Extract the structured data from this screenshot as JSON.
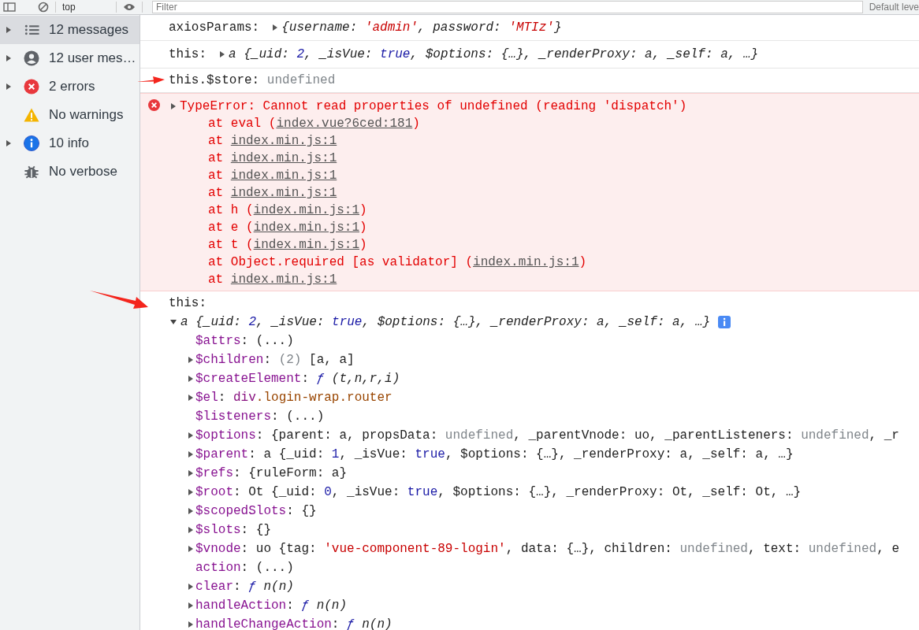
{
  "toolbar": {
    "context": "top",
    "filter": {
      "placeholder": "Filter"
    },
    "levels": "Default leve"
  },
  "sidebar": {
    "items": [
      {
        "label": "12 messages",
        "kind": "list",
        "expandable": true,
        "selected": true
      },
      {
        "label": "12 user mes…",
        "kind": "user",
        "expandable": true,
        "selected": false
      },
      {
        "label": "2 errors",
        "kind": "error",
        "expandable": true,
        "selected": false
      },
      {
        "label": "No warnings",
        "kind": "warning",
        "expandable": false,
        "selected": false
      },
      {
        "label": "10 info",
        "kind": "info",
        "expandable": true,
        "selected": false
      },
      {
        "label": "No verbose",
        "kind": "verbose",
        "expandable": false,
        "selected": false
      }
    ]
  },
  "console": {
    "messages": [
      {
        "kind": "log",
        "lines": [
          {
            "parts": [
              {
                "kind": "text",
                "segs": [
                  {
                    "kind": "plain",
                    "text": "axiosParams:"
                  }
                ]
              },
              {
                "kind": "toggle",
                "expanded": false
              },
              {
                "kind": "text",
                "segs": [
                  {
                    "kind": "italic",
                    "text": "{username: "
                  },
                  {
                    "kind": "istring",
                    "text": "'admin'"
                  },
                  {
                    "kind": "italic",
                    "text": ", password: "
                  },
                  {
                    "kind": "istring",
                    "text": "'MTIz'"
                  },
                  {
                    "kind": "italic",
                    "text": "}"
                  }
                ]
              }
            ]
          }
        ]
      },
      {
        "kind": "log",
        "lines": [
          {
            "parts": [
              {
                "kind": "text",
                "segs": [
                  {
                    "kind": "plain",
                    "text": "this:"
                  }
                ]
              },
              {
                "kind": "toggle",
                "expanded": false
              },
              {
                "kind": "text",
                "segs": [
                  {
                    "kind": "italic",
                    "text": "a {_uid: "
                  },
                  {
                    "kind": "inumber",
                    "text": "2"
                  },
                  {
                    "kind": "italic",
                    "text": ", _isVue: "
                  },
                  {
                    "kind": "inumber",
                    "text": "true"
                  },
                  {
                    "kind": "italic",
                    "text": ", $options: {…}, _renderProxy: a, _self: a, …}"
                  }
                ]
              }
            ]
          }
        ]
      },
      {
        "kind": "log",
        "lines": [
          {
            "parts": [
              {
                "kind": "text",
                "segs": [
                  {
                    "kind": "plain",
                    "text": "this.$store: "
                  },
                  {
                    "kind": "undef",
                    "text": "undefined"
                  }
                ]
              }
            ]
          }
        ]
      },
      {
        "kind": "error",
        "lines": [
          {
            "parts": [
              {
                "kind": "toggle",
                "expanded": false
              },
              {
                "kind": "text",
                "segs": [
                  {
                    "kind": "err",
                    "text": "TypeError: Cannot read properties of undefined (reading 'dispatch')"
                  }
                ]
              }
            ]
          },
          {
            "parts": [
              {
                "kind": "text",
                "segs": [
                  {
                    "kind": "err",
                    "text": "at eval ("
                  },
                  {
                    "kind": "link",
                    "text": "index.vue?6ced:181"
                  },
                  {
                    "kind": "err",
                    "text": ")"
                  }
                ]
              }
            ]
          },
          {
            "parts": [
              {
                "kind": "text",
                "segs": [
                  {
                    "kind": "err",
                    "text": "at "
                  },
                  {
                    "kind": "link",
                    "text": "index.min.js:1"
                  }
                ]
              }
            ]
          },
          {
            "parts": [
              {
                "kind": "text",
                "segs": [
                  {
                    "kind": "err",
                    "text": "at "
                  },
                  {
                    "kind": "link",
                    "text": "index.min.js:1"
                  }
                ]
              }
            ]
          },
          {
            "parts": [
              {
                "kind": "text",
                "segs": [
                  {
                    "kind": "err",
                    "text": "at "
                  },
                  {
                    "kind": "link",
                    "text": "index.min.js:1"
                  }
                ]
              }
            ]
          },
          {
            "parts": [
              {
                "kind": "text",
                "segs": [
                  {
                    "kind": "err",
                    "text": "at "
                  },
                  {
                    "kind": "link",
                    "text": "index.min.js:1"
                  }
                ]
              }
            ]
          },
          {
            "parts": [
              {
                "kind": "text",
                "segs": [
                  {
                    "kind": "err",
                    "text": "at h ("
                  },
                  {
                    "kind": "link",
                    "text": "index.min.js:1"
                  },
                  {
                    "kind": "err",
                    "text": ")"
                  }
                ]
              }
            ]
          },
          {
            "parts": [
              {
                "kind": "text",
                "segs": [
                  {
                    "kind": "err",
                    "text": "at e ("
                  },
                  {
                    "kind": "link",
                    "text": "index.min.js:1"
                  },
                  {
                    "kind": "err",
                    "text": ")"
                  }
                ]
              }
            ]
          },
          {
            "parts": [
              {
                "kind": "text",
                "segs": [
                  {
                    "kind": "err",
                    "text": "at t ("
                  },
                  {
                    "kind": "link",
                    "text": "index.min.js:1"
                  },
                  {
                    "kind": "err",
                    "text": ")"
                  }
                ]
              }
            ]
          },
          {
            "parts": [
              {
                "kind": "text",
                "segs": [
                  {
                    "kind": "err",
                    "text": "at Object.required [as validator] ("
                  },
                  {
                    "kind": "link",
                    "text": "index.min.js:1"
                  },
                  {
                    "kind": "err",
                    "text": ")"
                  }
                ]
              }
            ]
          },
          {
            "parts": [
              {
                "kind": "text",
                "segs": [
                  {
                    "kind": "err",
                    "text": "at "
                  },
                  {
                    "kind": "link",
                    "text": "index.min.js:1"
                  }
                ]
              }
            ]
          }
        ]
      },
      {
        "kind": "tree",
        "lines": [
          {
            "parts": [
              {
                "kind": "text",
                "segs": [
                  {
                    "kind": "plain",
                    "text": "this:"
                  }
                ]
              }
            ]
          },
          {
            "parts": [
              {
                "kind": "toggle",
                "expanded": true
              },
              {
                "kind": "text",
                "segs": [
                  {
                    "kind": "italic",
                    "text": "a {_uid: "
                  },
                  {
                    "kind": "inumber",
                    "text": "2"
                  },
                  {
                    "kind": "italic",
                    "text": ", _isVue: "
                  },
                  {
                    "kind": "inumber",
                    "text": "true"
                  },
                  {
                    "kind": "italic",
                    "text": ", $options: {…}, _renderProxy: a, _self: a, …}"
                  }
                ]
              },
              {
                "kind": "info"
              }
            ]
          }
        ],
        "children": [
          {
            "expandable": false,
            "segs": [
              {
                "kind": "key",
                "text": "$attrs"
              },
              {
                "kind": "plain",
                "text": ": (...)"
              }
            ]
          },
          {
            "expandable": true,
            "expanded": false,
            "segs": [
              {
                "kind": "key",
                "text": "$children"
              },
              {
                "kind": "plain",
                "text": ": "
              },
              {
                "kind": "undef",
                "text": "(2)"
              },
              {
                "kind": "plain",
                "text": " [a, a]"
              }
            ]
          },
          {
            "expandable": true,
            "expanded": false,
            "segs": [
              {
                "kind": "key",
                "text": "$createElement"
              },
              {
                "kind": "plain",
                "text": ": "
              },
              {
                "kind": "func",
                "text": "ƒ"
              },
              {
                "kind": "italic",
                "text": " (t,n,r,i)"
              }
            ]
          },
          {
            "expandable": true,
            "expanded": false,
            "segs": [
              {
                "kind": "key",
                "text": "$el"
              },
              {
                "kind": "plain",
                "text": ": "
              },
              {
                "kind": "tag",
                "text": "div"
              },
              {
                "kind": "cls",
                "text": ".login-wrap.router"
              }
            ]
          },
          {
            "expandable": false,
            "segs": [
              {
                "kind": "key",
                "text": "$listeners"
              },
              {
                "kind": "plain",
                "text": ": (...)"
              }
            ]
          },
          {
            "expandable": true,
            "expanded": false,
            "segs": [
              {
                "kind": "key",
                "text": "$options"
              },
              {
                "kind": "plain",
                "text": ": {parent: a, propsData: "
              },
              {
                "kind": "undef",
                "text": "undefined"
              },
              {
                "kind": "plain",
                "text": ", _parentVnode: uo, _parentListeners: "
              },
              {
                "kind": "undef",
                "text": "undefined"
              },
              {
                "kind": "plain",
                "text": ", _r"
              }
            ]
          },
          {
            "expandable": true,
            "expanded": false,
            "segs": [
              {
                "kind": "key",
                "text": "$parent"
              },
              {
                "kind": "plain",
                "text": ": a {_uid: "
              },
              {
                "kind": "number",
                "text": "1"
              },
              {
                "kind": "plain",
                "text": ", _isVue: "
              },
              {
                "kind": "number",
                "text": "true"
              },
              {
                "kind": "plain",
                "text": ", $options: {…}, _renderProxy: a, _self: a, …}"
              }
            ]
          },
          {
            "expandable": true,
            "expanded": false,
            "segs": [
              {
                "kind": "key",
                "text": "$refs"
              },
              {
                "kind": "plain",
                "text": ": {ruleForm: a}"
              }
            ]
          },
          {
            "expandable": true,
            "expanded": false,
            "segs": [
              {
                "kind": "key",
                "text": "$root"
              },
              {
                "kind": "plain",
                "text": ": Ot {_uid: "
              },
              {
                "kind": "number",
                "text": "0"
              },
              {
                "kind": "plain",
                "text": ", _isVue: "
              },
              {
                "kind": "number",
                "text": "true"
              },
              {
                "kind": "plain",
                "text": ", $options: {…}, _renderProxy: Ot, _self: Ot, …}"
              }
            ]
          },
          {
            "expandable": true,
            "expanded": false,
            "segs": [
              {
                "kind": "key",
                "text": "$scopedSlots"
              },
              {
                "kind": "plain",
                "text": ": {}"
              }
            ]
          },
          {
            "expandable": true,
            "expanded": false,
            "segs": [
              {
                "kind": "key",
                "text": "$slots"
              },
              {
                "kind": "plain",
                "text": ": {}"
              }
            ]
          },
          {
            "expandable": true,
            "expanded": false,
            "segs": [
              {
                "kind": "key",
                "text": "$vnode"
              },
              {
                "kind": "plain",
                "text": ": uo {tag: "
              },
              {
                "kind": "string",
                "text": "'vue-component-89-login'"
              },
              {
                "kind": "plain",
                "text": ", data: {…}, children: "
              },
              {
                "kind": "undef",
                "text": "undefined"
              },
              {
                "kind": "plain",
                "text": ", text: "
              },
              {
                "kind": "undef",
                "text": "undefined"
              },
              {
                "kind": "plain",
                "text": ", e"
              }
            ]
          },
          {
            "expandable": false,
            "segs": [
              {
                "kind": "key",
                "text": "action"
              },
              {
                "kind": "plain",
                "text": ": (...)"
              }
            ]
          },
          {
            "expandable": true,
            "expanded": false,
            "segs": [
              {
                "kind": "key",
                "text": "clear"
              },
              {
                "kind": "plain",
                "text": ": "
              },
              {
                "kind": "func",
                "text": "ƒ"
              },
              {
                "kind": "italic",
                "text": " n(n)"
              }
            ]
          },
          {
            "expandable": true,
            "expanded": false,
            "segs": [
              {
                "kind": "key",
                "text": "handleAction"
              },
              {
                "kind": "plain",
                "text": ": "
              },
              {
                "kind": "func",
                "text": "ƒ"
              },
              {
                "kind": "italic",
                "text": " n(n)"
              }
            ]
          },
          {
            "expandable": true,
            "expanded": false,
            "segs": [
              {
                "kind": "key",
                "text": "handleChangeAction"
              },
              {
                "kind": "plain",
                "text": ": "
              },
              {
                "kind": "func",
                "text": "ƒ"
              },
              {
                "kind": "italic",
                "text": " n(n)"
              }
            ]
          }
        ]
      }
    ]
  }
}
